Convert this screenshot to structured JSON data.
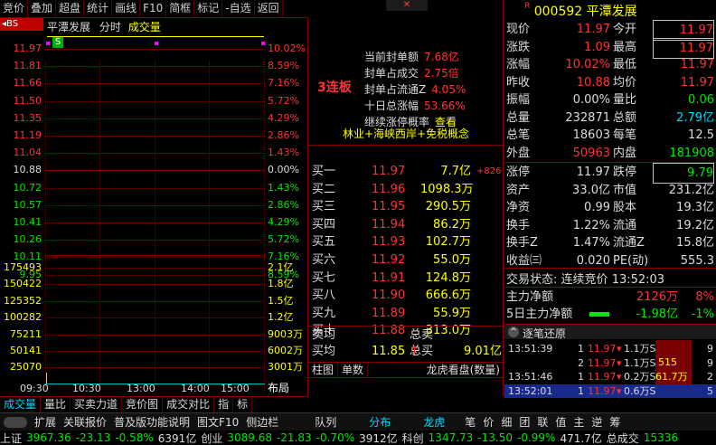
{
  "toolbar": {
    "items": [
      "竞价",
      "叠加",
      "超盘",
      "统计",
      "画线",
      "F10",
      "简框",
      "标记",
      "-自选",
      "返回"
    ]
  },
  "chart": {
    "name": "平潭发展",
    "mode": "分时",
    "indicator": "成交量",
    "badge": "S",
    "bs_label": "◂BS",
    "price_ticks": [
      "11.97",
      "11.81",
      "11.66",
      "11.50",
      "11.35",
      "11.19",
      "11.04",
      "10.88",
      "10.72",
      "10.57",
      "10.41",
      "10.26",
      "10.11",
      "9.95"
    ],
    "pct_ticks": [
      "10.02%",
      "8.59%",
      "7.16%",
      "5.72%",
      "4.29%",
      "2.86%",
      "1.43%",
      "0.00%",
      "1.43%",
      "2.86%",
      "4.29%",
      "5.72%",
      "7.16%",
      "8.59%"
    ],
    "vol_ticks": [
      "175493",
      "150422",
      "125352",
      "100282",
      "75211",
      "50141",
      "25070"
    ],
    "vol_ticks_r": [
      "2.1亿",
      "1.8亿",
      "1.5亿",
      "1.2亿",
      "9003万",
      "6002万",
      "3001万"
    ],
    "time_ticks": [
      "09:30",
      "10:30",
      "13:00",
      "14:00",
      "15:00"
    ],
    "layout_btn": "布局"
  },
  "bottom_tabs": [
    "成交量",
    "量比",
    "买卖力道",
    "竞价图",
    "成交对比",
    "指",
    "标"
  ],
  "statusbar": {
    "toggle": "",
    "items": [
      "扩展",
      "关联报价",
      "普及版功能说明",
      "图文F10",
      "侧边栏",
      "队列",
      "分布",
      "龙虎",
      "笔",
      "价",
      "细",
      "团",
      "联",
      "值",
      "主",
      "逆",
      "筹"
    ]
  },
  "index_bar": [
    {
      "name": "上证",
      "val": "3967.36",
      "chg": "-23.13",
      "pct": "-0.58%",
      "amt": "6391亿"
    },
    {
      "name": "创业",
      "val": "3089.68",
      "chg": "-21.83",
      "pct": "-0.70%",
      "amt": "3912亿"
    },
    {
      "name": "科创",
      "val": "1347.73",
      "chg": "-13.50",
      "pct": "-0.99%",
      "amt": "471.7亿"
    },
    {
      "name": "总成交",
      "val": "15336"
    }
  ],
  "mid": {
    "limit_label": "3连板",
    "info": [
      {
        "k": "当前封单额",
        "v": "7.68亿"
      },
      {
        "k": "封单占成交",
        "v": "2.75倍"
      },
      {
        "k": "封单占流通Z",
        "v": "4.05%"
      },
      {
        "k": "十日总涨幅",
        "v": "53.66%"
      },
      {
        "k": "继续涨停概率",
        "v": "查看"
      }
    ],
    "concepts": "林业+海峡西岸+免税概念",
    "bids": [
      {
        "lvl": "买一",
        "p": "11.97",
        "v": "7.7亿",
        "x": "+826"
      },
      {
        "lvl": "买二",
        "p": "11.96",
        "v": "1098.3万",
        "x": ""
      },
      {
        "lvl": "买三",
        "p": "11.95",
        "v": "290.5万",
        "x": ""
      },
      {
        "lvl": "买四",
        "p": "11.94",
        "v": "86.2万",
        "x": ""
      },
      {
        "lvl": "买五",
        "p": "11.93",
        "v": "102.7万",
        "x": ""
      },
      {
        "lvl": "买六",
        "p": "11.92",
        "v": "55.0万",
        "x": ""
      },
      {
        "lvl": "买七",
        "p": "11.91",
        "v": "124.8万",
        "x": ""
      },
      {
        "lvl": "买八",
        "p": "11.90",
        "v": "666.6万",
        "x": ""
      },
      {
        "lvl": "买九",
        "p": "11.89",
        "v": "55.9万",
        "x": ""
      },
      {
        "lvl": "买十",
        "p": "11.88",
        "v": "313.0万",
        "x": ""
      }
    ],
    "sell_avg": "卖均",
    "sell_total": "总卖",
    "buy_avg": "买均",
    "buy_avg_val": "11.85",
    "buy_total": "总买",
    "buy_total_val": "9.01亿",
    "tabs": [
      "柱图",
      "单数",
      "龙虎看盘(数量)"
    ]
  },
  "right": {
    "code_prefix": "R",
    "code": "000592",
    "name": "平潭发展",
    "quote": [
      {
        "l": "现价",
        "lv": "11.97",
        "r": "今开",
        "rv": "11.97"
      },
      {
        "l": "涨跌",
        "lv": "1.09",
        "r": "最高",
        "rv": "11.97"
      },
      {
        "l": "涨幅",
        "lv": "10.02%",
        "r": "最低",
        "rv": "11.97"
      },
      {
        "l": "昨收",
        "lv": "10.88",
        "r": "均价",
        "rv": "11.97"
      },
      {
        "l": "振幅",
        "lv": "0.00%",
        "r": "量比",
        "rv": "0.06"
      },
      {
        "l": "总量",
        "lv": "232871",
        "r": "总额",
        "rv": "2.79亿"
      },
      {
        "l": "总笔",
        "lv": "18603",
        "r": "每笔",
        "rv": "12.5"
      },
      {
        "l": "外盘",
        "lv": "50963",
        "r": "内盘",
        "rv": "181908"
      }
    ],
    "limit": [
      {
        "l": "涨停",
        "lv": "11.97",
        "r": "跌停",
        "rv": "9.79"
      },
      {
        "l": "资产",
        "lv": "33.0亿",
        "r": "市值",
        "rv": "231.2亿"
      },
      {
        "l": "净资",
        "lv": "0.99",
        "r": "股本",
        "rv": "19.3亿"
      },
      {
        "l": "换手",
        "lv": "1.22%",
        "r": "流通",
        "rv": "19.2亿"
      },
      {
        "l": "换手Z",
        "lv": "1.47%",
        "r": "流通Z",
        "rv": "15.8亿"
      },
      {
        "l": "收益㈢",
        "lv": "0.020",
        "r": "PE(动)",
        "rv": "555.3"
      }
    ],
    "trade_state_label": "交易状态:",
    "trade_state": "连续竞价",
    "trade_time": "13:52:03",
    "flow": [
      {
        "l": "主力净额",
        "v": "2126万",
        "p": "8%"
      },
      {
        "l": "5日主力净额",
        "v": "-1.98亿",
        "p": "-1%"
      }
    ],
    "ticks_title": "逐笔还原",
    "ticks": [
      {
        "t": "13:51:39",
        "n": "1",
        "p": "11.97",
        "v": "1.1万S",
        "x": "9"
      },
      {
        "t": "",
        "n": "2",
        "p": "11.97",
        "v": "1.1万S",
        "x": "9"
      },
      {
        "t": "13:51:46",
        "n": "1",
        "p": "11.97",
        "v": "0.2万S",
        "x": "2"
      },
      {
        "t": "13:52:01",
        "n": "1",
        "p": "11.97",
        "v": "0.6万S",
        "x": "5"
      }
    ],
    "tick_box": [
      "515",
      "61.7万"
    ]
  },
  "colors": {
    "up": "#ff3232",
    "down": "#00e600",
    "frame": "#800000"
  }
}
